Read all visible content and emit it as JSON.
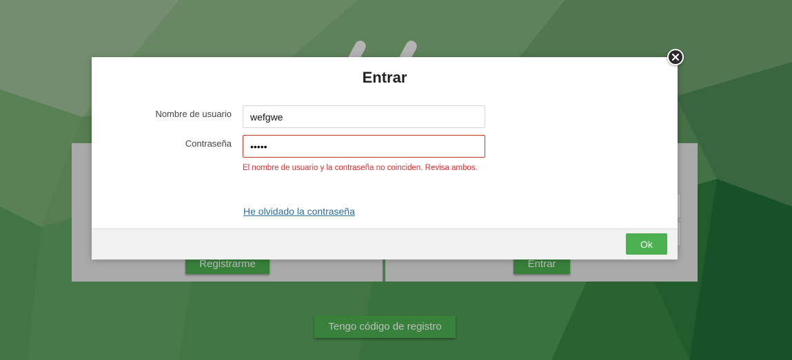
{
  "background": {
    "colors": [
      "#8fb58a",
      "#6fa26b",
      "#4f9a57",
      "#3f8a48",
      "#2d7a3a",
      "#1f6e35"
    ],
    "register_button": "Registrarme",
    "login_button": "Entrar",
    "registration_code_button": "Tengo código de registro"
  },
  "login_dialog": {
    "title": "Entrar",
    "username_label": "Nombre de usuario",
    "username_value": "wefgwe",
    "password_label": "Contraseña",
    "password_value": "*****",
    "error_message": "El nombre de usuario y la contraseña no coinciden. Revisa ambos.",
    "forgot_password_link": "He olvidado la contraseña",
    "ok_button": "Ok",
    "close_icon": "close-icon"
  },
  "colors": {
    "accent": "#4caf50",
    "error": "#d03030",
    "link": "#2d6e9e"
  }
}
